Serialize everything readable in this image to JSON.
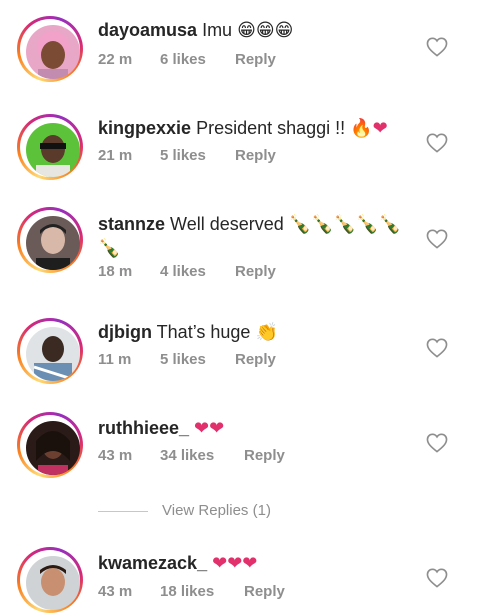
{
  "comments": [
    {
      "username": "dayoamusa",
      "text": "Imu",
      "emoji": "😁😁😁",
      "time": "22 m",
      "likes": "6 likes",
      "reply": "Reply"
    },
    {
      "username": "kingpexxie",
      "text": "President shaggi !!",
      "emoji": "🔥❤",
      "time": "21 m",
      "likes": "5 likes",
      "reply": "Reply"
    },
    {
      "username": "stannze",
      "text": "Well deserved",
      "emoji": "🍾🍾🍾🍾🍾",
      "emoji2": "🍾",
      "time": "18 m",
      "likes": "4 likes",
      "reply": "Reply"
    },
    {
      "username": "djbign",
      "text": "That’s huge",
      "emoji": "👏",
      "time": "11 m",
      "likes": "5 likes",
      "reply": "Reply"
    },
    {
      "username": "ruthhieee_",
      "text": "",
      "emoji": "❤❤",
      "time": "43 m",
      "likes": "34 likes",
      "reply": "Reply"
    },
    {
      "username": "kwamezack_",
      "text": "",
      "emoji": "❤❤❤",
      "time": "43 m",
      "likes": "18 likes",
      "reply": "Reply"
    }
  ],
  "view_replies": "View Replies (1)",
  "colors": {
    "heart": "#e1306c",
    "muted": "#8e8e8e",
    "text": "#262626"
  },
  "icons": {
    "like": "heart-outline-icon"
  }
}
